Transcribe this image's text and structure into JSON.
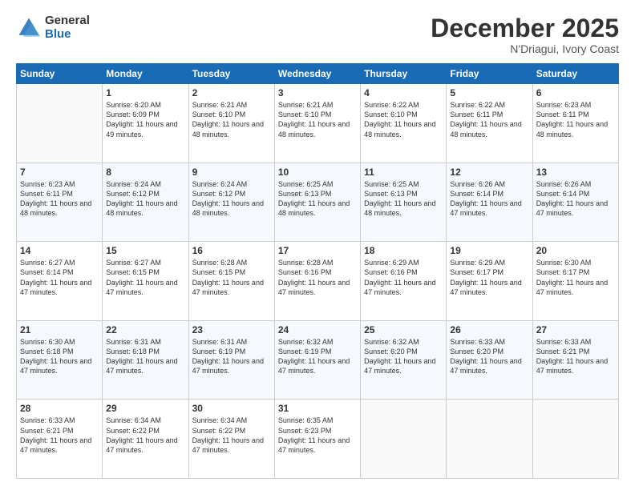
{
  "logo": {
    "general": "General",
    "blue": "Blue"
  },
  "header": {
    "month": "December 2025",
    "location": "N'Driagui, Ivory Coast"
  },
  "days_header": [
    "Sunday",
    "Monday",
    "Tuesday",
    "Wednesday",
    "Thursday",
    "Friday",
    "Saturday"
  ],
  "weeks": [
    [
      {
        "day": "",
        "sunrise": "",
        "sunset": "",
        "daylight": ""
      },
      {
        "day": "1",
        "sunrise": "Sunrise: 6:20 AM",
        "sunset": "Sunset: 6:09 PM",
        "daylight": "Daylight: 11 hours and 49 minutes."
      },
      {
        "day": "2",
        "sunrise": "Sunrise: 6:21 AM",
        "sunset": "Sunset: 6:10 PM",
        "daylight": "Daylight: 11 hours and 48 minutes."
      },
      {
        "day": "3",
        "sunrise": "Sunrise: 6:21 AM",
        "sunset": "Sunset: 6:10 PM",
        "daylight": "Daylight: 11 hours and 48 minutes."
      },
      {
        "day": "4",
        "sunrise": "Sunrise: 6:22 AM",
        "sunset": "Sunset: 6:10 PM",
        "daylight": "Daylight: 11 hours and 48 minutes."
      },
      {
        "day": "5",
        "sunrise": "Sunrise: 6:22 AM",
        "sunset": "Sunset: 6:11 PM",
        "daylight": "Daylight: 11 hours and 48 minutes."
      },
      {
        "day": "6",
        "sunrise": "Sunrise: 6:23 AM",
        "sunset": "Sunset: 6:11 PM",
        "daylight": "Daylight: 11 hours and 48 minutes."
      }
    ],
    [
      {
        "day": "7",
        "sunrise": "Sunrise: 6:23 AM",
        "sunset": "Sunset: 6:11 PM",
        "daylight": "Daylight: 11 hours and 48 minutes."
      },
      {
        "day": "8",
        "sunrise": "Sunrise: 6:24 AM",
        "sunset": "Sunset: 6:12 PM",
        "daylight": "Daylight: 11 hours and 48 minutes."
      },
      {
        "day": "9",
        "sunrise": "Sunrise: 6:24 AM",
        "sunset": "Sunset: 6:12 PM",
        "daylight": "Daylight: 11 hours and 48 minutes."
      },
      {
        "day": "10",
        "sunrise": "Sunrise: 6:25 AM",
        "sunset": "Sunset: 6:13 PM",
        "daylight": "Daylight: 11 hours and 48 minutes."
      },
      {
        "day": "11",
        "sunrise": "Sunrise: 6:25 AM",
        "sunset": "Sunset: 6:13 PM",
        "daylight": "Daylight: 11 hours and 48 minutes."
      },
      {
        "day": "12",
        "sunrise": "Sunrise: 6:26 AM",
        "sunset": "Sunset: 6:14 PM",
        "daylight": "Daylight: 11 hours and 47 minutes."
      },
      {
        "day": "13",
        "sunrise": "Sunrise: 6:26 AM",
        "sunset": "Sunset: 6:14 PM",
        "daylight": "Daylight: 11 hours and 47 minutes."
      }
    ],
    [
      {
        "day": "14",
        "sunrise": "Sunrise: 6:27 AM",
        "sunset": "Sunset: 6:14 PM",
        "daylight": "Daylight: 11 hours and 47 minutes."
      },
      {
        "day": "15",
        "sunrise": "Sunrise: 6:27 AM",
        "sunset": "Sunset: 6:15 PM",
        "daylight": "Daylight: 11 hours and 47 minutes."
      },
      {
        "day": "16",
        "sunrise": "Sunrise: 6:28 AM",
        "sunset": "Sunset: 6:15 PM",
        "daylight": "Daylight: 11 hours and 47 minutes."
      },
      {
        "day": "17",
        "sunrise": "Sunrise: 6:28 AM",
        "sunset": "Sunset: 6:16 PM",
        "daylight": "Daylight: 11 hours and 47 minutes."
      },
      {
        "day": "18",
        "sunrise": "Sunrise: 6:29 AM",
        "sunset": "Sunset: 6:16 PM",
        "daylight": "Daylight: 11 hours and 47 minutes."
      },
      {
        "day": "19",
        "sunrise": "Sunrise: 6:29 AM",
        "sunset": "Sunset: 6:17 PM",
        "daylight": "Daylight: 11 hours and 47 minutes."
      },
      {
        "day": "20",
        "sunrise": "Sunrise: 6:30 AM",
        "sunset": "Sunset: 6:17 PM",
        "daylight": "Daylight: 11 hours and 47 minutes."
      }
    ],
    [
      {
        "day": "21",
        "sunrise": "Sunrise: 6:30 AM",
        "sunset": "Sunset: 6:18 PM",
        "daylight": "Daylight: 11 hours and 47 minutes."
      },
      {
        "day": "22",
        "sunrise": "Sunrise: 6:31 AM",
        "sunset": "Sunset: 6:18 PM",
        "daylight": "Daylight: 11 hours and 47 minutes."
      },
      {
        "day": "23",
        "sunrise": "Sunrise: 6:31 AM",
        "sunset": "Sunset: 6:19 PM",
        "daylight": "Daylight: 11 hours and 47 minutes."
      },
      {
        "day": "24",
        "sunrise": "Sunrise: 6:32 AM",
        "sunset": "Sunset: 6:19 PM",
        "daylight": "Daylight: 11 hours and 47 minutes."
      },
      {
        "day": "25",
        "sunrise": "Sunrise: 6:32 AM",
        "sunset": "Sunset: 6:20 PM",
        "daylight": "Daylight: 11 hours and 47 minutes."
      },
      {
        "day": "26",
        "sunrise": "Sunrise: 6:33 AM",
        "sunset": "Sunset: 6:20 PM",
        "daylight": "Daylight: 11 hours and 47 minutes."
      },
      {
        "day": "27",
        "sunrise": "Sunrise: 6:33 AM",
        "sunset": "Sunset: 6:21 PM",
        "daylight": "Daylight: 11 hours and 47 minutes."
      }
    ],
    [
      {
        "day": "28",
        "sunrise": "Sunrise: 6:33 AM",
        "sunset": "Sunset: 6:21 PM",
        "daylight": "Daylight: 11 hours and 47 minutes."
      },
      {
        "day": "29",
        "sunrise": "Sunrise: 6:34 AM",
        "sunset": "Sunset: 6:22 PM",
        "daylight": "Daylight: 11 hours and 47 minutes."
      },
      {
        "day": "30",
        "sunrise": "Sunrise: 6:34 AM",
        "sunset": "Sunset: 6:22 PM",
        "daylight": "Daylight: 11 hours and 47 minutes."
      },
      {
        "day": "31",
        "sunrise": "Sunrise: 6:35 AM",
        "sunset": "Sunset: 6:23 PM",
        "daylight": "Daylight: 11 hours and 47 minutes."
      },
      {
        "day": "",
        "sunrise": "",
        "sunset": "",
        "daylight": ""
      },
      {
        "day": "",
        "sunrise": "",
        "sunset": "",
        "daylight": ""
      },
      {
        "day": "",
        "sunrise": "",
        "sunset": "",
        "daylight": ""
      }
    ]
  ]
}
